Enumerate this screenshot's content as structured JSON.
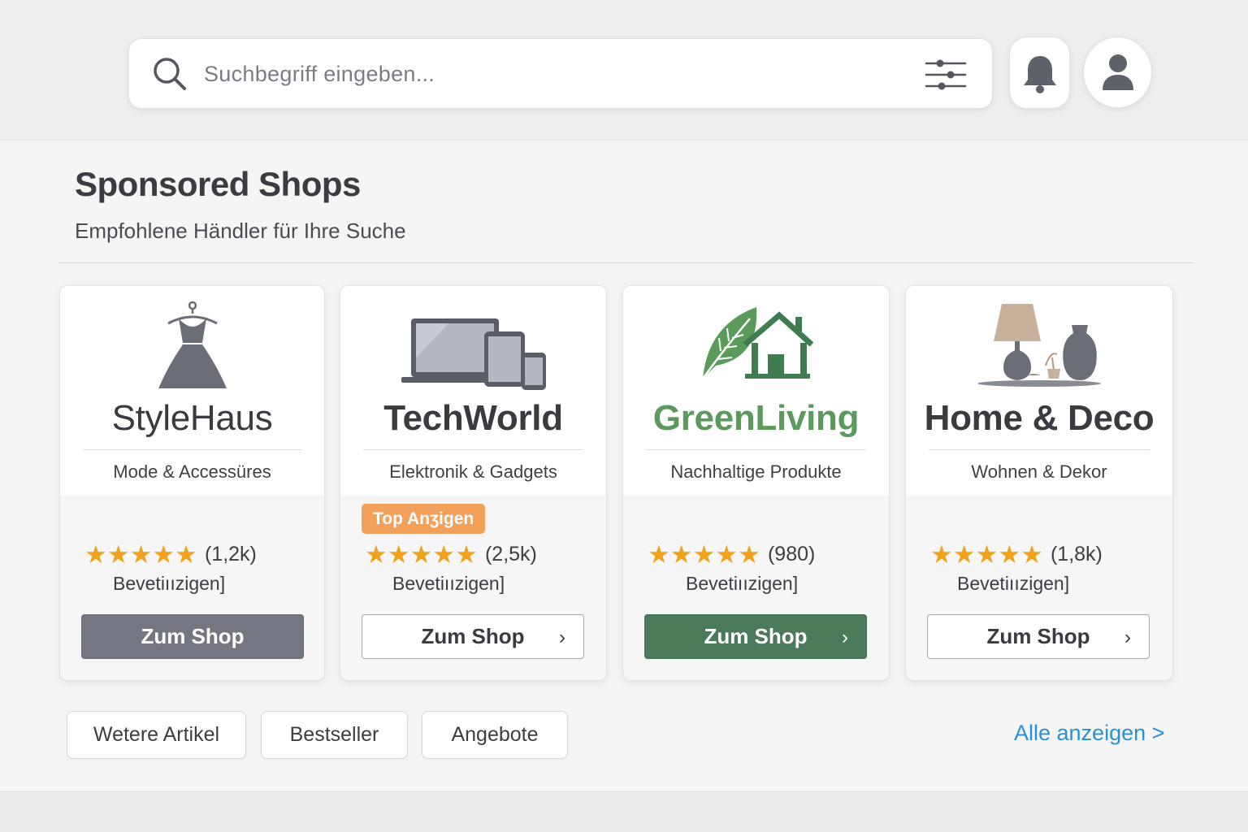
{
  "search": {
    "placeholder": "Suchbegriff eingeben...",
    "search_icon": "search-icon",
    "filter_icon": "sliders-icon"
  },
  "header_actions": {
    "notifications_icon": "bell-icon",
    "profile_icon": "user-icon"
  },
  "section": {
    "title": "Sponsored Shops",
    "subtitle": "Empfohlene Händler für Ihre Suche"
  },
  "shops": [
    {
      "name": "StyleHaus",
      "category": "Mode & Accessüres",
      "logo_icon": "dress-icon",
      "rating_count": "(1,2k)",
      "rating_label": "Bevetiıızigen]",
      "button_label": "Zum Shop",
      "button_style": "grey"
    },
    {
      "name": "TechWorld",
      "category": "Elektronik & Gadgets",
      "logo_icon": "devices-icon",
      "badge": "Top Anʒigen",
      "rating_count": "(2,5k)",
      "rating_label": "Bevetiıızigen]",
      "button_label": "Zum Shop",
      "button_style": "outline"
    },
    {
      "name": "GreenLiving",
      "category": "Nachhaltige Produkte",
      "logo_icon": "leaf-house-icon",
      "rating_count": "(980)",
      "rating_label": "Bevetiıızigen]",
      "button_label": "Zum Shop",
      "button_style": "green"
    },
    {
      "name": "Home & Deco",
      "category": "Wohnen & Dekor",
      "logo_icon": "lamp-vase-icon",
      "rating_count": "(1,8k)",
      "rating_label": "Bevetiıızigen]",
      "button_label": "Zum Shop",
      "button_style": "outline"
    }
  ],
  "stars": "★★★★★",
  "chevron": "›",
  "chips": [
    "Wetere Artikel",
    "Bestseller",
    "Angebote"
  ],
  "all_link": "Alle anzeigen >",
  "colors": {
    "accent_green": "#4a7a5a",
    "leaf_green": "#5fa05f",
    "badge_orange": "#f2a05a",
    "star_gold": "#f0a21c",
    "link_blue": "#2b8fd6",
    "button_grey": "#747782"
  }
}
